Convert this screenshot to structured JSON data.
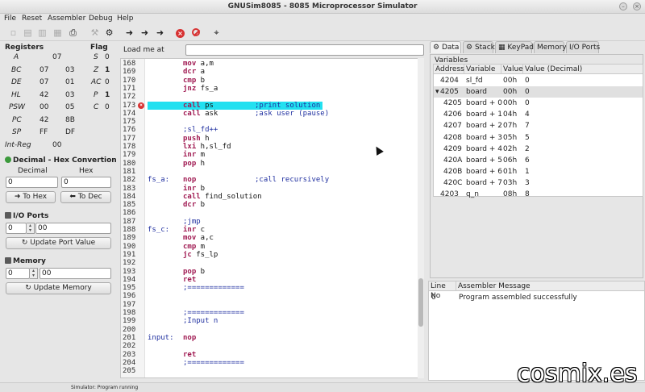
{
  "window": {
    "title": "GNUSim8085 - 8085 Microprocessor Simulator",
    "btn_min": "–",
    "btn_close": "×"
  },
  "menu": {
    "file": "File",
    "reset": "Reset",
    "assembler": "Assembler",
    "debug": "Debug",
    "help": "Help"
  },
  "registers": {
    "title": "Registers",
    "rows": [
      {
        "name": "A",
        "v1": "07",
        "v2": ""
      },
      {
        "name": "BC",
        "v1": "07",
        "v2": "03"
      },
      {
        "name": "DE",
        "v1": "07",
        "v2": "01"
      },
      {
        "name": "HL",
        "v1": "42",
        "v2": "03"
      },
      {
        "name": "PSW",
        "v1": "00",
        "v2": "05"
      },
      {
        "name": "PC",
        "v1": "42",
        "v2": "8B"
      },
      {
        "name": "SP",
        "v1": "FF",
        "v2": "DF"
      },
      {
        "name": "Int-Reg",
        "v1": "00",
        "v2": ""
      }
    ]
  },
  "flags": {
    "title": "Flag",
    "rows": [
      {
        "name": "S",
        "value": "0"
      },
      {
        "name": "Z",
        "value": "1"
      },
      {
        "name": "AC",
        "value": "0"
      },
      {
        "name": "P",
        "value": "1"
      },
      {
        "name": "C",
        "value": "0"
      }
    ]
  },
  "converter": {
    "title": "Decimal - Hex Convertion",
    "dec_label": "Decimal",
    "hex_label": "Hex",
    "dec_value": "0",
    "hex_value": "0",
    "to_hex": "To Hex",
    "to_dec": "To Dec"
  },
  "ioports": {
    "title": "I/O Ports",
    "port": "0",
    "value": "00",
    "update": "Update Port Value"
  },
  "memory": {
    "title": "Memory",
    "addr": "0",
    "value": "00",
    "update": "Update Memory"
  },
  "load": {
    "label": "Load me at",
    "value": ""
  },
  "editor": {
    "lines": [
      {
        "n": "168",
        "label": "",
        "op": "mov",
        "args": "a,m",
        "comment": ""
      },
      {
        "n": "169",
        "label": "",
        "op": "dcr",
        "args": "a",
        "comment": ""
      },
      {
        "n": "170",
        "label": "",
        "op": "cmp",
        "args": "b",
        "comment": ""
      },
      {
        "n": "171",
        "label": "",
        "op": "jnz",
        "args": "fs_a",
        "comment": ""
      },
      {
        "n": "172",
        "label": "",
        "op": "",
        "args": "",
        "comment": ""
      },
      {
        "n": "173",
        "label": "",
        "op": "call",
        "args": "ps",
        "comment": ";print solution",
        "bp": true,
        "hl": true
      },
      {
        "n": "174",
        "label": "",
        "op": "call",
        "args": "ask",
        "comment": ";ask user (pause)"
      },
      {
        "n": "175",
        "label": "",
        "op": "",
        "args": "",
        "comment": ""
      },
      {
        "n": "176",
        "label": "",
        "op": "",
        "args": "",
        "comment": ";sl_fd++"
      },
      {
        "n": "177",
        "label": "",
        "op": "push",
        "args": "h",
        "comment": ""
      },
      {
        "n": "178",
        "label": "",
        "op": "lxi",
        "args": "h,sl_fd",
        "comment": ""
      },
      {
        "n": "179",
        "label": "",
        "op": "inr",
        "args": "m",
        "comment": ""
      },
      {
        "n": "180",
        "label": "",
        "op": "pop",
        "args": "h",
        "comment": ""
      },
      {
        "n": "181",
        "label": "",
        "op": "",
        "args": "",
        "comment": ""
      },
      {
        "n": "182",
        "label": "fs_a:",
        "op": "nop",
        "args": "",
        "comment": ";call recursively"
      },
      {
        "n": "183",
        "label": "",
        "op": "inr",
        "args": "b",
        "comment": ""
      },
      {
        "n": "184",
        "label": "",
        "op": "call",
        "args": "find_solution",
        "comment": ""
      },
      {
        "n": "185",
        "label": "",
        "op": "dcr",
        "args": "b",
        "comment": ""
      },
      {
        "n": "186",
        "label": "",
        "op": "",
        "args": "",
        "comment": ""
      },
      {
        "n": "187",
        "label": "",
        "op": "",
        "args": "",
        "comment": ";jmp"
      },
      {
        "n": "188",
        "label": "fs_c:",
        "op": "inr",
        "args": "c",
        "comment": ""
      },
      {
        "n": "189",
        "label": "",
        "op": "mov",
        "args": "a,c",
        "comment": ""
      },
      {
        "n": "190",
        "label": "",
        "op": "cmp",
        "args": "m",
        "comment": ""
      },
      {
        "n": "191",
        "label": "",
        "op": "jc",
        "args": "fs_lp",
        "comment": ""
      },
      {
        "n": "192",
        "label": "",
        "op": "",
        "args": "",
        "comment": ""
      },
      {
        "n": "193",
        "label": "",
        "op": "pop",
        "args": "b",
        "comment": ""
      },
      {
        "n": "194",
        "label": "",
        "op": "ret",
        "args": "",
        "comment": ""
      },
      {
        "n": "195",
        "label": "",
        "op": "",
        "args": "",
        "comment": ";============="
      },
      {
        "n": "196",
        "label": "",
        "op": "",
        "args": "",
        "comment": ""
      },
      {
        "n": "197",
        "label": "",
        "op": "",
        "args": "",
        "comment": ""
      },
      {
        "n": "198",
        "label": "",
        "op": "",
        "args": "",
        "comment": ";============="
      },
      {
        "n": "199",
        "label": "",
        "op": "",
        "args": "",
        "comment": ";Input n"
      },
      {
        "n": "200",
        "label": "",
        "op": "",
        "args": "",
        "comment": ""
      },
      {
        "n": "201",
        "label": "input:",
        "op": "nop",
        "args": "",
        "comment": ""
      },
      {
        "n": "202",
        "label": "",
        "op": "",
        "args": "",
        "comment": ""
      },
      {
        "n": "203",
        "label": "",
        "op": "ret",
        "args": "",
        "comment": ""
      },
      {
        "n": "204",
        "label": "",
        "op": "",
        "args": "",
        "comment": ";============="
      },
      {
        "n": "205",
        "label": "",
        "op": "",
        "args": "",
        "comment": ""
      }
    ]
  },
  "tabs": [
    "Data",
    "Stack",
    "KeyPad",
    "Memory",
    "I/O Ports"
  ],
  "variables": {
    "title": "Variables",
    "headers": [
      "Address",
      "Variable",
      "Value",
      "Value (Decimal)"
    ],
    "rows": [
      {
        "addr": "4204",
        "var": "sl_fd",
        "hex": "00h",
        "dec": "0",
        "indent": false,
        "expander": ""
      },
      {
        "addr": "4205",
        "var": "board",
        "hex": "00h",
        "dec": "0",
        "indent": false,
        "expander": "▾"
      },
      {
        "addr": "4205",
        "var": "board + 0",
        "hex": "00h",
        "dec": "0",
        "indent": true,
        "expander": ""
      },
      {
        "addr": "4206",
        "var": "board + 1",
        "hex": "04h",
        "dec": "4",
        "indent": true,
        "expander": ""
      },
      {
        "addr": "4207",
        "var": "board + 2",
        "hex": "07h",
        "dec": "7",
        "indent": true,
        "expander": ""
      },
      {
        "addr": "4208",
        "var": "board + 3",
        "hex": "05h",
        "dec": "5",
        "indent": true,
        "expander": ""
      },
      {
        "addr": "4209",
        "var": "board + 4",
        "hex": "02h",
        "dec": "2",
        "indent": true,
        "expander": ""
      },
      {
        "addr": "420A",
        "var": "board + 5",
        "hex": "06h",
        "dec": "6",
        "indent": true,
        "expander": ""
      },
      {
        "addr": "420B",
        "var": "board + 6",
        "hex": "01h",
        "dec": "1",
        "indent": true,
        "expander": ""
      },
      {
        "addr": "420C",
        "var": "board + 7",
        "hex": "03h",
        "dec": "3",
        "indent": true,
        "expander": ""
      },
      {
        "addr": "4203",
        "var": "q_n",
        "hex": "08h",
        "dec": "8",
        "indent": false,
        "expander": ""
      }
    ]
  },
  "messages": {
    "headers": [
      "Line No",
      "Assembler Message"
    ],
    "rows": [
      {
        "line": "0",
        "msg": "Program assembled successfully"
      }
    ]
  },
  "status": {
    "text": "Simulator: Program running"
  },
  "watermark": "cosmix.es",
  "colors": {
    "highlight": "#22e0f0",
    "breakpoint": "#d73232",
    "keyword": "#a01a52",
    "comment": "#2030a0"
  }
}
